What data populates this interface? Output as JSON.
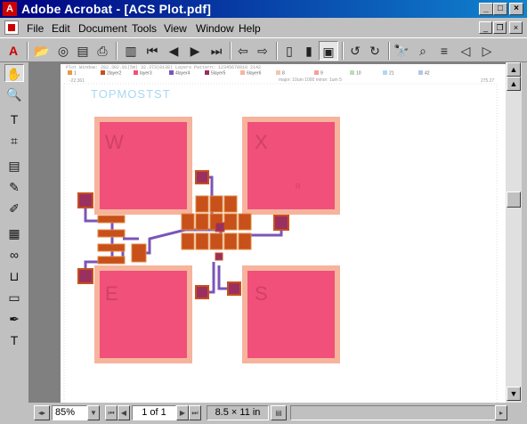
{
  "window": {
    "title": "Adobe Acrobat - [ACS Plot.pdf]"
  },
  "menu": [
    "File",
    "Edit",
    "Document",
    "Tools",
    "View",
    "Window",
    "Help"
  ],
  "plot": {
    "header_line": "Plot Window: 282.302.01(5m) 32.373(8138) Layers Pattern: 12345678910  2142",
    "legend": [
      "1",
      "2layer2",
      "layer3",
      "4layer4",
      "5layer5",
      "6layer6",
      "8",
      "9",
      "10",
      "21",
      "42"
    ],
    "subheader": "major: 10um 1000 minor: 1um 5",
    "coord_left": "-22.361",
    "coord_right": "275.27",
    "design_label": "TOPMOSTST",
    "pad_labels": [
      "W",
      "X",
      "E",
      "S"
    ],
    "small_label": "R",
    "colors": {
      "pad_fill": "#f0507a",
      "pad_border": "#f6b49c",
      "wire": "#7a55b8",
      "device": "#c8501a",
      "device_border": "#e08a40"
    }
  },
  "status": {
    "zoom": "85%",
    "page": "1 of 1",
    "page_size": "8.5 × 11 in"
  }
}
